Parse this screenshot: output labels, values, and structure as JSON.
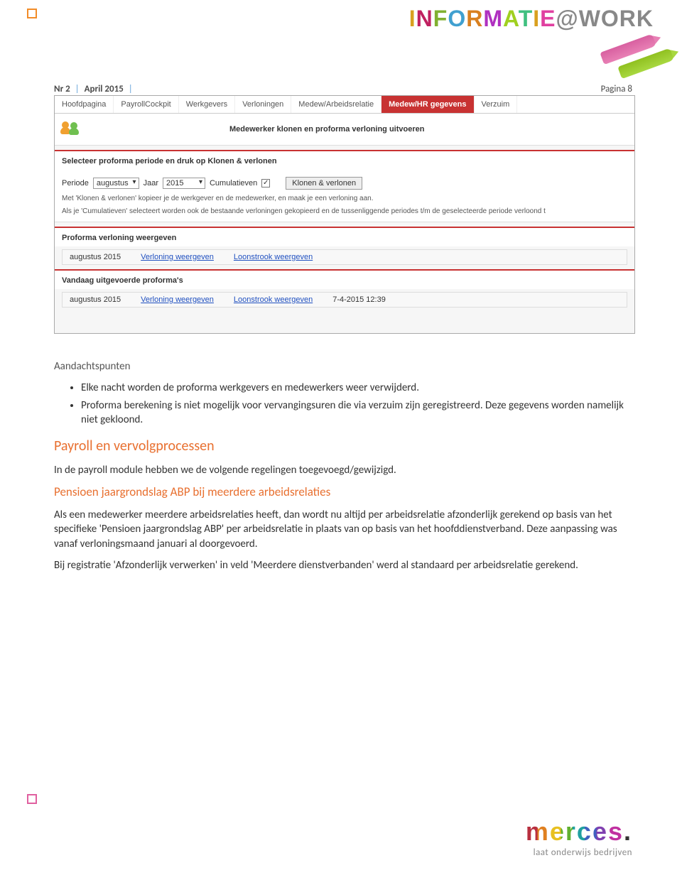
{
  "header": {
    "logo_prefix_i": "I",
    "logo_n": "N",
    "logo_f": "F",
    "logo_o": "O",
    "logo_r": "R",
    "logo_m": "M",
    "logo_a": "A",
    "logo_t": "T",
    "logo_i2": "I",
    "logo_e": "E",
    "logo_at": "@",
    "logo_work": "WORK"
  },
  "issue": {
    "nr": "Nr 2",
    "month": "April 2015",
    "page": "Pagina 8",
    "sep": "|"
  },
  "screenshot": {
    "tabs": [
      "Hoofdpagina",
      "PayrollCockpit",
      "Werkgevers",
      "Verloningen",
      "Medew/Arbeidsrelatie",
      "Medew/HR gegevens",
      "Verzuim"
    ],
    "active_tab_index": 5,
    "page_title": "Medewerker klonen en proforma verloning uitvoeren",
    "section1_title": "Selecteer proforma periode en druk op Klonen & verlonen",
    "form": {
      "period_label": "Periode",
      "period_value": "augustus",
      "year_label": "Jaar",
      "year_value": "2015",
      "cumul_label": "Cumulatieven",
      "cumul_checked": "✓",
      "button": "Klonen & verlonen",
      "help1": "Met 'Klonen & verlonen' kopieer je de werkgever en de medewerker, en maak je een verloning aan.",
      "help2": "Als je 'Cumulatieven' selecteert worden ook de bestaande verloningen gekopieerd en de tussenliggende periodes t/m de geselecteerde periode verloond t"
    },
    "section2_title": "Proforma verloning weergeven",
    "row2": {
      "period": "augustus 2015",
      "link1": "Verloning weergeven",
      "link2": "Loonstrook weergeven"
    },
    "section3_title": "Vandaag uitgevoerde proforma's",
    "row3": {
      "period": "augustus 2015",
      "link1": "Verloning weergeven",
      "link2": "Loonstrook weergeven",
      "ts": "7-4-2015 12:39"
    }
  },
  "content": {
    "aandachtspunten_title": "Aandachtspunten",
    "bullets": [
      "Elke nacht worden de proforma werkgevers en medewerkers weer verwijderd.",
      "Proforma berekening is niet mogelijk voor vervangingsuren die via verzuim zijn geregistreerd. Deze gegevens worden namelijk niet gekloond."
    ],
    "h_payroll": "Payroll en vervolgprocessen",
    "p_payroll_intro": "In de payroll module hebben we de volgende regelingen toegevoegd/gewijzigd.",
    "h_pensioen": "Pensioen jaargrondslag ABP bij meerdere arbeidsrelaties",
    "p_pensioen": "Als een medewerker meerdere arbeidsrelaties heeft, dan wordt nu altijd per arbeidsrelatie afzonderlijk gerekend op basis van het specifieke 'Pensioen jaargrondslag ABP' per arbeidsrelatie in plaats van op basis van het hoofddienstverband. Deze aanpassing was vanaf verloningsmaand januari al doorgevoerd.",
    "p_registratie": "Bij registratie 'Afzonderlijk verwerken' in veld 'Meerdere dienstverbanden' werd al standaard per arbeidsrelatie gerekend."
  },
  "footer": {
    "brand": "merces",
    "dot": ".",
    "payoff": "laat onderwijs bedrijven"
  }
}
